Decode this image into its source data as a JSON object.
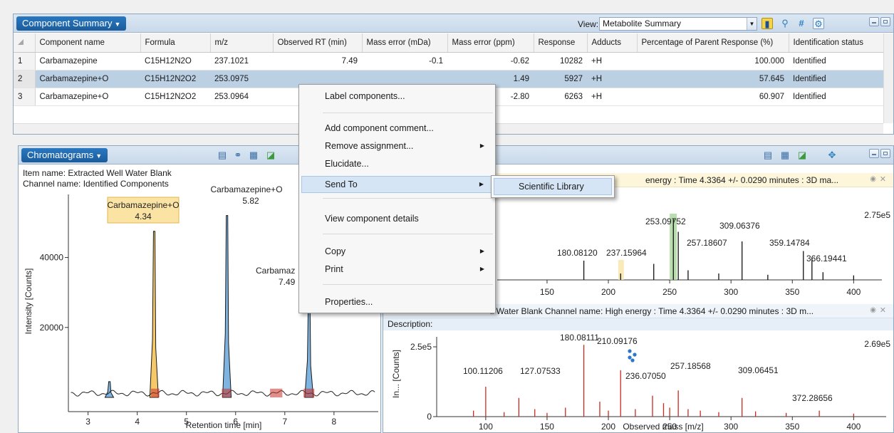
{
  "summary": {
    "title": "Component Summary",
    "view_label": "View:",
    "view_value": "Metabolite Summary",
    "columns": [
      "Component name",
      "Formula",
      "m/z",
      "Observed RT (min)",
      "Mass error (mDa)",
      "Mass error (ppm)",
      "Response",
      "Adducts",
      "Percentage of Parent Response (%)",
      "Identification status"
    ],
    "rows": [
      {
        "n": "1",
        "name": "Carbamazepine",
        "formula": "C15H12N2O",
        "mz": "237.1021",
        "rt": "7.49",
        "mda": "-0.1",
        "ppm": "-0.62",
        "resp": "10282",
        "adduct": "+H",
        "pct": "100.000",
        "status": "Identified"
      },
      {
        "n": "2",
        "name": "Carbamazepine+O",
        "formula": "C15H12N2O2",
        "mz": "253.0975",
        "rt": "",
        "mda": "",
        "ppm": "1.49",
        "resp": "5927",
        "adduct": "+H",
        "pct": "57.645",
        "status": "Identified"
      },
      {
        "n": "3",
        "name": "Carbamazepine+O",
        "formula": "C15H12N2O2",
        "mz": "253.0964",
        "rt": "",
        "mda": "",
        "ppm": "-2.80",
        "resp": "6263",
        "adduct": "+H",
        "pct": "60.907",
        "status": "Identified"
      }
    ],
    "icons": {
      "tube": "test-tube-icon",
      "molecule": "molecule-icon",
      "hash": "hash-icon",
      "settings": "settings-icon"
    }
  },
  "chromatogram": {
    "title": "Chromatograms",
    "item_name": "Item name: Extracted Well Water Blank",
    "channel_name": "Channel name: Identified Components",
    "ylabel": "Intensity [Counts]",
    "xlabel": "Retention time [min]",
    "yticks": [
      "40000",
      "20000"
    ],
    "xticks": [
      "3",
      "4",
      "5",
      "6",
      "7",
      "8"
    ],
    "peak_labels": {
      "p1_name": "Carbamazepine+O",
      "p1_rt": "4.34",
      "p2_name": "Carbamazepine+O",
      "p2_rt": "5.82",
      "p3_name": "Carbamaz",
      "p3_rt": "7.49"
    },
    "peaks_rt": [
      3.43,
      4.34,
      5.82,
      7.49
    ],
    "peaks_height": [
      4500,
      47500,
      52000,
      30500
    ]
  },
  "spectrum_top": {
    "header": "energy : Time 4.3364 +/- 0.0290 minutes : 3D ma...",
    "max_label": "2.75e5",
    "xticks": [
      "150",
      "200",
      "250",
      "300",
      "350",
      "400"
    ],
    "peak_labels": [
      "253.09752",
      "309.06376",
      "359.14784",
      "180.08120",
      "237.15964",
      "257.18607",
      "366.19441"
    ]
  },
  "spectrum_bottom": {
    "header": "ll Water Blank  Channel name: High energy : Time 4.3364 +/- 0.0290 minutes : 3D m...",
    "description": "Description:",
    "ylabel": "In... [Counts]",
    "ytick": "2.5e5",
    "yzero": "0",
    "max_label": "2.69e5",
    "xlabel": "Observed mass [m/z]",
    "xticks": [
      "100",
      "150",
      "200",
      "250",
      "300",
      "350",
      "400"
    ],
    "peak_labels": [
      "180.08111",
      "210.09176",
      "100.11206",
      "127.07533",
      "236.07050",
      "257.18568",
      "309.06451",
      "372.28656"
    ]
  },
  "context_menu": {
    "items": [
      "Label components...",
      "Add component comment...",
      "Remove assignment...",
      "Elucidate...",
      "Send To",
      "View component details",
      "Copy",
      "Print",
      "Properties..."
    ],
    "submenu": "Scientific Library"
  },
  "colors": {
    "accent": "#1b5c9c",
    "selected_row": "#bcd0e4",
    "peak_fill": "#7fb3e0",
    "highlight_peak": "#f5c86a",
    "low_energy": "#000000",
    "high_energy": "#cc2a1e"
  }
}
